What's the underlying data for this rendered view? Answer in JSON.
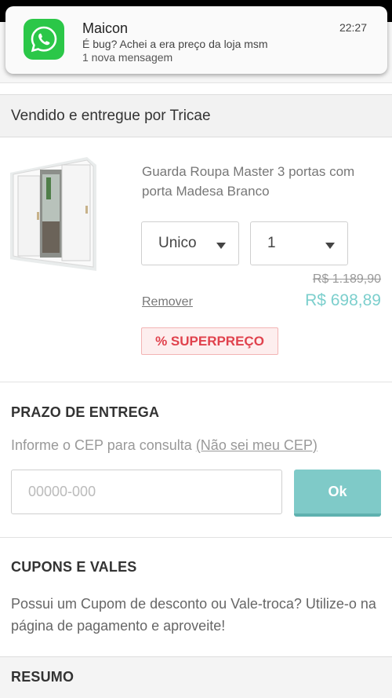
{
  "notification": {
    "app_icon": "whatsapp-icon",
    "title": "Maicon",
    "time": "22:27",
    "message": "É bug? Achei a era preço da loja msm",
    "count": "1 nova mensagem"
  },
  "seller": {
    "text": "Vendido e entregue por Tricae"
  },
  "product": {
    "name": "Guarda Roupa Master 3 portas com porta Madesa Branco",
    "size_value": "Unico",
    "qty_value": "1",
    "old_price": "R$ 1.189,90",
    "new_price": "R$ 698,89",
    "remove_label": "Remover",
    "badge_label": "% SUPERPREÇO"
  },
  "delivery": {
    "title": "PRAZO DE ENTREGA",
    "hint": "Informe o CEP para consulta",
    "help_link": "(Não sei meu CEP)",
    "cep_placeholder": "00000-000",
    "ok_label": "Ok"
  },
  "coupons": {
    "title": "CUPONS E VALES",
    "text": "Possui um Cupom de desconto ou Vale-troca? Utilize-o na página de pagamento e aproveite!"
  },
  "summary": {
    "title": "RESUMO"
  },
  "colors": {
    "accent": "#7fcac8",
    "price": "#7ccfcd",
    "badge_red": "#e0424d",
    "whatsapp": "#2bc748"
  }
}
